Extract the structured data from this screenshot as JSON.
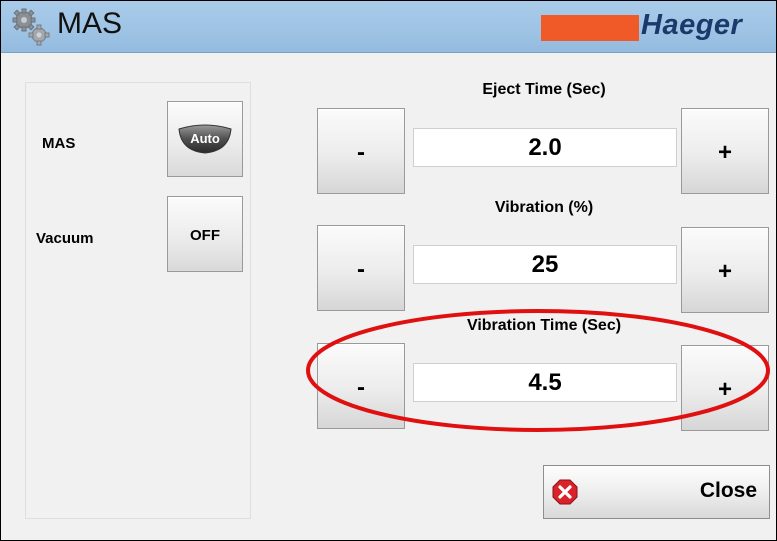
{
  "window": {
    "title": "MAS",
    "brand": "Haeger",
    "colors": {
      "titlebar": "#9ec3e4",
      "brand_bar": "#f05a28",
      "brand_text": "#1b3a6b",
      "highlight": "#e01010"
    }
  },
  "left_panel": {
    "mas": {
      "label": "MAS",
      "button": "Auto"
    },
    "vacuum": {
      "label": "Vacuum",
      "button": "OFF"
    }
  },
  "eject_time": {
    "title": "Eject Time (Sec)",
    "minus": "-",
    "value": "2.0",
    "plus": "+"
  },
  "vibration": {
    "title": "Vibration (%)",
    "minus": "-",
    "value": "25",
    "plus": "+"
  },
  "vibration_time": {
    "title": "Vibration Time (Sec)",
    "minus": "-",
    "value": "4.5",
    "plus": "+"
  },
  "close": {
    "label": "Close"
  },
  "icons": [
    "gears-icon",
    "close-x-icon"
  ]
}
